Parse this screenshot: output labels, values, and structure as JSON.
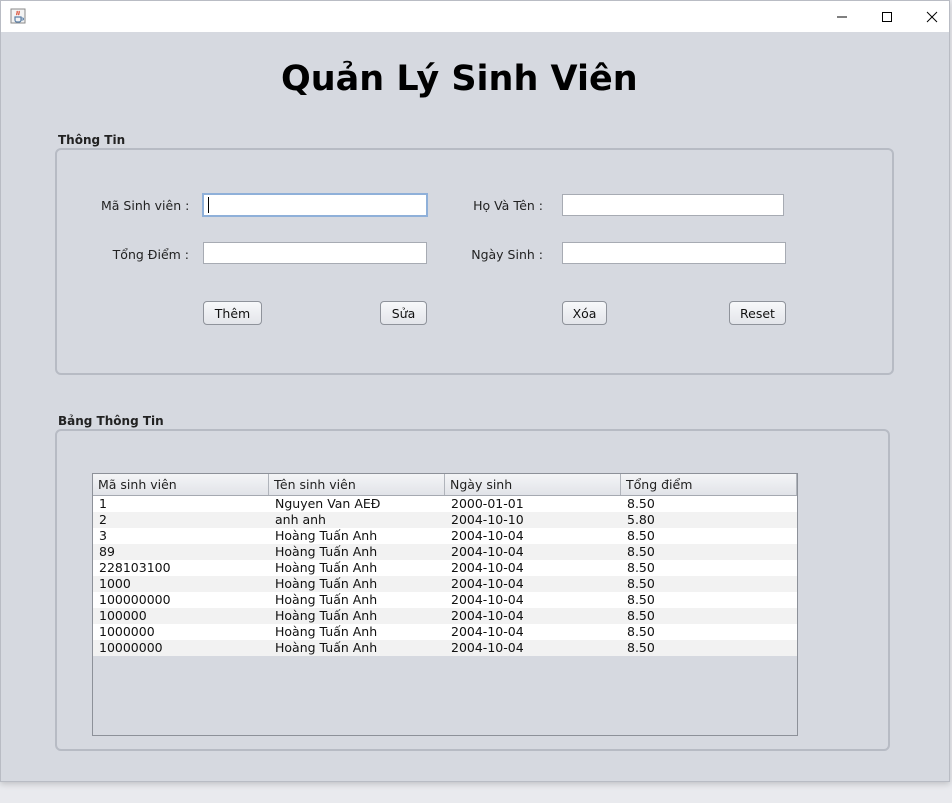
{
  "window": {
    "close_color": "#000000"
  },
  "header": {
    "title": "Quản Lý Sinh Viên"
  },
  "info_group": {
    "label": "Thông Tin",
    "fields": {
      "student_id_label": "Mã Sinh viên :",
      "student_id_value": "",
      "full_name_label": "Họ Và Tên :",
      "full_name_value": "",
      "total_score_label": "Tổng Điểm :",
      "total_score_value": "",
      "birth_date_label": "Ngày Sinh :",
      "birth_date_value": ""
    },
    "buttons": {
      "add": "Thêm",
      "edit": "Sửa",
      "delete": "Xóa",
      "reset": "Reset"
    }
  },
  "table_group": {
    "label": "Bảng Thông Tin",
    "columns": [
      "Mã sinh viên",
      "Tên sinh viên",
      "Ngày sinh",
      "Tổng điểm"
    ],
    "rows": [
      [
        "1",
        "Nguyen Van AEĐ",
        "2000-01-01",
        "8.50"
      ],
      [
        "2",
        "anh anh",
        "2004-10-10",
        "5.80"
      ],
      [
        "3",
        "Hoàng Tuấn Anh",
        "2004-10-04",
        "8.50"
      ],
      [
        "89",
        "Hoàng Tuấn Anh",
        "2004-10-04",
        "8.50"
      ],
      [
        "228103100",
        "Hoàng Tuấn Anh",
        "2004-10-04",
        "8.50"
      ],
      [
        "1000",
        "Hoàng Tuấn Anh",
        "2004-10-04",
        "8.50"
      ],
      [
        "100000000",
        "Hoàng Tuấn Anh",
        "2004-10-04",
        "8.50"
      ],
      [
        "100000",
        "Hoàng Tuấn Anh",
        "2004-10-04",
        "8.50"
      ],
      [
        "1000000",
        "Hoàng Tuấn Anh",
        "2004-10-04",
        "8.50"
      ],
      [
        "10000000",
        "Hoàng Tuấn Anh",
        "2004-10-04",
        "8.50"
      ]
    ]
  },
  "icons": {
    "app": "java-cup-icon",
    "minimize": "minimize-icon",
    "maximize": "maximize-icon",
    "close": "close-icon"
  },
  "colors": {
    "window_bg": "#d6d9e0",
    "focus_border": "#8fb0d9"
  }
}
